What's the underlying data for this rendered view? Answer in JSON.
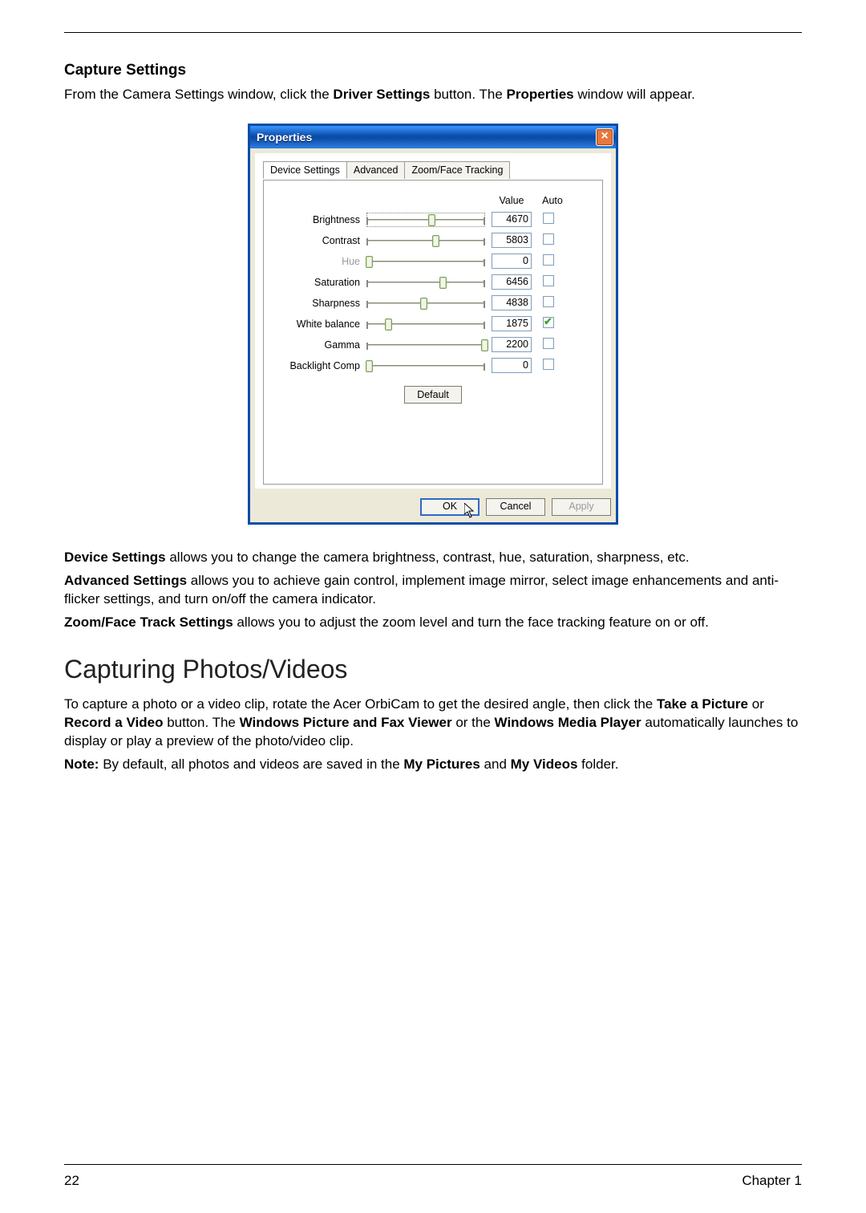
{
  "doc": {
    "section_title": "Capture Settings",
    "section_body_pre": "From the Camera Settings window, click the ",
    "section_body_bold1": "Driver Settings",
    "section_body_mid": " button. The ",
    "section_body_bold2": "Properties",
    "section_body_post": " window will appear.",
    "para_device_bold": "Device Settings",
    "para_device_rest": " allows you to change the camera brightness, contrast, hue, saturation, sharpness, etc.",
    "para_adv_bold": "Advanced Settings",
    "para_adv_rest": " allows you to achieve gain control, implement image mirror, select image enhancements and anti-flicker settings, and turn on/off the camera indicator.",
    "para_zoom_bold": "Zoom/Face Track Settings",
    "para_zoom_rest": " allows you to adjust the zoom level and turn the face tracking feature on or off.",
    "h2": "Capturing Photos/Videos",
    "cap_pre": "To capture a photo or a video clip, rotate the Acer OrbiCam to get the desired angle, then click the ",
    "cap_b1": "Take a Picture",
    "cap_mid1": " or ",
    "cap_b2": "Record a Video",
    "cap_mid2": " button. The ",
    "cap_b3": "Windows Picture and Fax Viewer",
    "cap_mid3": " or the ",
    "cap_b4": "Windows Media Player",
    "cap_post": " automatically launches to display or play a preview of the photo/video clip.",
    "note_b1": "Note:",
    "note_mid1": " By default, all photos and videos are saved in the ",
    "note_b2": "My Pictures",
    "note_mid2": " and ",
    "note_b3": "My Videos",
    "note_post": " folder.",
    "page_number": "22",
    "chapter": "Chapter 1"
  },
  "window": {
    "title": "Properties",
    "tabs": [
      "Device Settings",
      "Advanced",
      "Zoom/Face Tracking"
    ],
    "header_value": "Value",
    "header_auto": "Auto",
    "rows": [
      {
        "label": "Brightness",
        "value": "4670",
        "pos": 55,
        "auto": false,
        "disabled": false,
        "focused": true
      },
      {
        "label": "Contrast",
        "value": "5803",
        "pos": 58,
        "auto": false,
        "disabled": false
      },
      {
        "label": "Hue",
        "value": "0",
        "pos": 2,
        "auto": false,
        "disabled": true
      },
      {
        "label": "Saturation",
        "value": "6456",
        "pos": 64,
        "auto": false,
        "disabled": false
      },
      {
        "label": "Sharpness",
        "value": "4838",
        "pos": 48,
        "auto": false,
        "disabled": false
      },
      {
        "label": "White balance",
        "value": "1875",
        "pos": 18,
        "auto": true,
        "disabled": false
      },
      {
        "label": "Gamma",
        "value": "2200",
        "pos": 99,
        "auto": false,
        "disabled": false
      },
      {
        "label": "Backlight Comp",
        "value": "0",
        "pos": 2,
        "auto": false,
        "disabled": false
      }
    ],
    "default_btn": "Default",
    "ok": "OK",
    "cancel": "Cancel",
    "apply": "Apply"
  }
}
